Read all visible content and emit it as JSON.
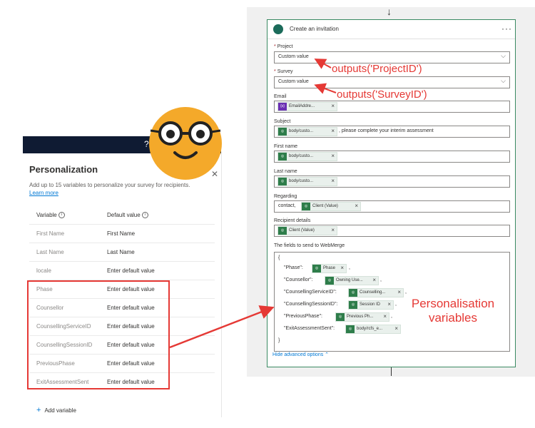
{
  "left_panel": {
    "help_icon_label": "?",
    "title": "Personalization",
    "close_label": "✕",
    "description": "Add up to 15 variables to personalize your survey for recipients.",
    "learn_more": "Learn more",
    "col_variable": "Variable",
    "col_default": "Default value",
    "rows": [
      {
        "variable": "First Name",
        "default": "First Name"
      },
      {
        "variable": "Last Name",
        "default": "Last Name"
      },
      {
        "variable": "locale",
        "default": "Enter default value"
      },
      {
        "variable": "Phase",
        "default": "Enter default value"
      },
      {
        "variable": "Counsellor",
        "default": "Enter default value"
      },
      {
        "variable": "CounsellingServiceID",
        "default": "Enter default value"
      },
      {
        "variable": "CounsellingSessionID",
        "default": "Enter default value"
      },
      {
        "variable": "PreviousPhase",
        "default": "Enter default value"
      },
      {
        "variable": "ExitAssessmentSent",
        "default": "Enter default value"
      }
    ],
    "add_variable": "Add variable"
  },
  "card": {
    "title": "Create an invitation",
    "menu": "···",
    "project_label": "Project",
    "project_value": "Custom value",
    "survey_label": "Survey",
    "survey_value": "Custom value",
    "required_mark": "*",
    "email_label": "Email",
    "email_token": "EmailAddre...",
    "subject_label": "Subject",
    "subject_token": "body/custo...",
    "subject_text": ", please complete your interim assessment",
    "firstname_label": "First name",
    "firstname_token": "body/custo...",
    "lastname_label": "Last name",
    "lastname_token": "body/custo...",
    "regarding_label": "Regarding",
    "regarding_text": "contact,",
    "regarding_token": "Client (Value)",
    "recipient_label": "Recipient details",
    "recipient_token": "Client (Value)",
    "fields_label": "The fields to send to WebMerge",
    "json_open": "{",
    "json_close": "}",
    "json_rows": [
      {
        "key": "\"Phase\":",
        "token": "Phase"
      },
      {
        "key": "\"Counsellor\":",
        "token": "Owning Use..."
      },
      {
        "key": "\"CounsellingServiceID\":",
        "token": "Counselling..."
      },
      {
        "key": "\"CounsellingSessionID\":",
        "token": "Session ID"
      },
      {
        "key": "\"PreviousPhase\":",
        "token": "Previous Ph..."
      },
      {
        "key": "\"ExitAssessmentSent\":",
        "token": "body/rcfs_e..."
      }
    ],
    "advanced": "Hide advanced options"
  },
  "annotations": {
    "project": "outputs('ProjectID')",
    "survey": "outputs('SurveyID')",
    "personalisation_line1": "Personalisation",
    "personalisation_line2": "variables"
  },
  "colors": {
    "accent_red": "#e53935",
    "header_navy": "#0f1b33",
    "token_green": "#2e7d4a",
    "link_blue": "#0078d4"
  }
}
